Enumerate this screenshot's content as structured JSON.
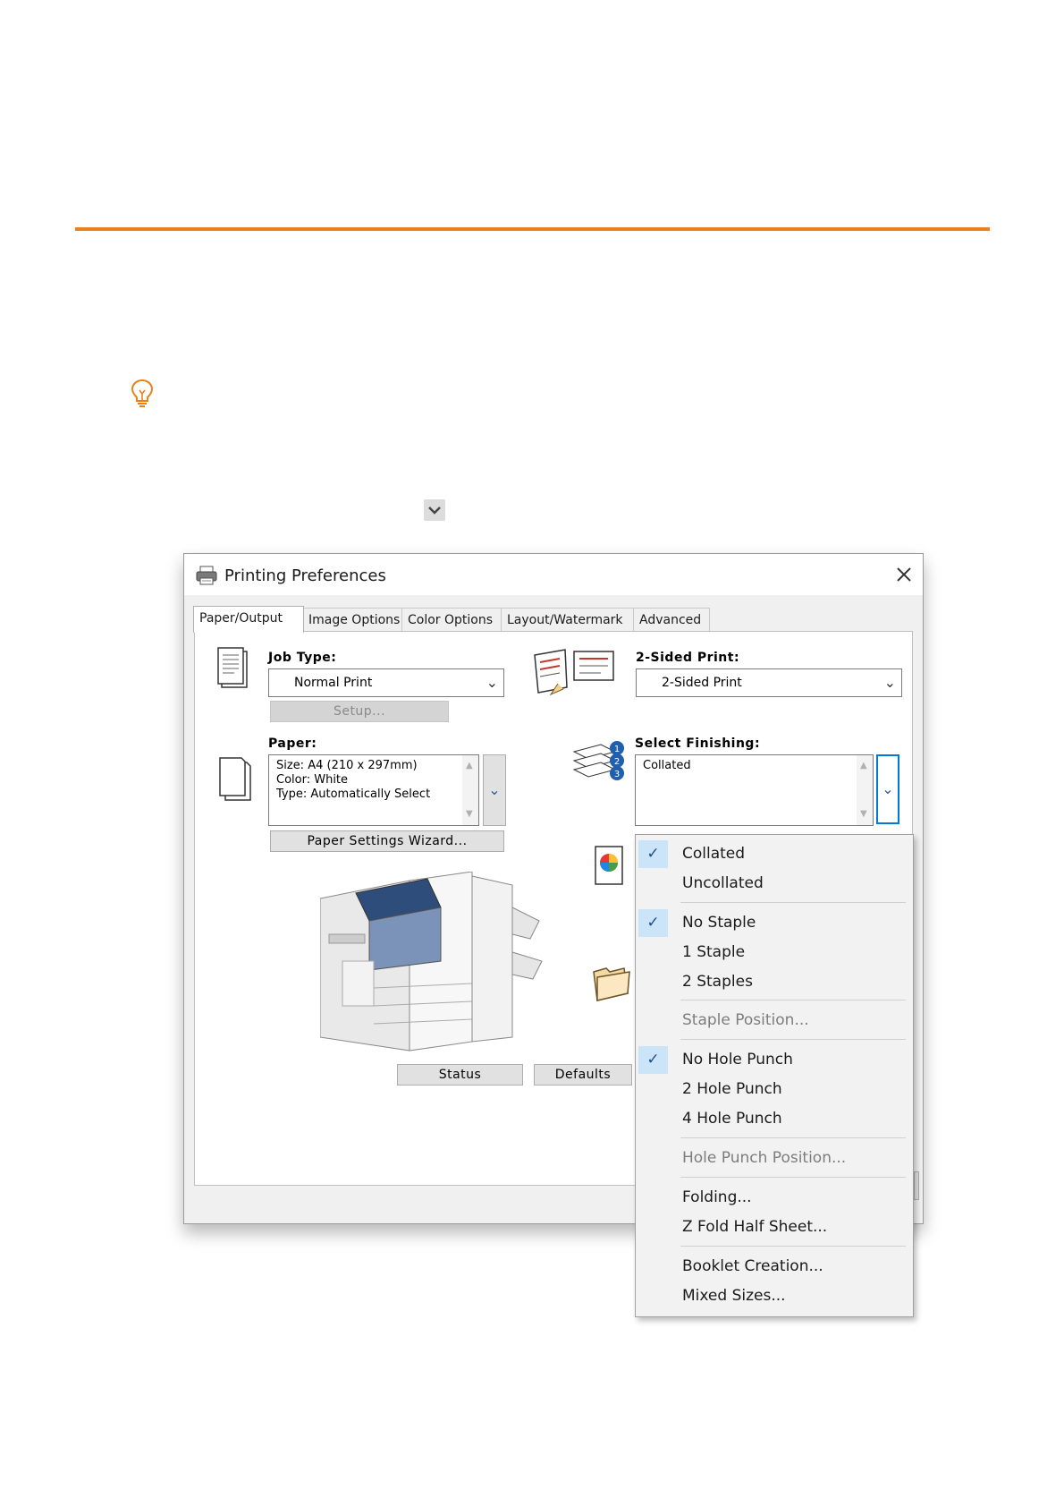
{
  "dialog": {
    "title": "Printing Preferences",
    "tabs": [
      "Paper/Output",
      "Image Options",
      "Color Options",
      "Layout/Watermark",
      "Advanced"
    ],
    "job_type": {
      "label": "Job Type:",
      "value": "Normal Print",
      "setup_label": "Setup..."
    },
    "two_sided": {
      "label": "2-Sided Print:",
      "value": "2-Sided Print"
    },
    "paper": {
      "label": "Paper:",
      "lines": [
        "Size: A4 (210 x 297mm)",
        "Color: White",
        "Type: Automatically Select"
      ],
      "wizard_label": "Paper Settings Wizard..."
    },
    "finishing": {
      "label": "Select Finishing:",
      "value": "Collated",
      "badges": [
        "1",
        "2",
        "3"
      ]
    },
    "status_label": "Status",
    "defaults_label": "Defaults"
  },
  "menu": {
    "items": [
      {
        "label": "Collated",
        "checked": true,
        "disabled": false
      },
      {
        "label": "Uncollated",
        "checked": false,
        "disabled": false
      },
      {
        "label": "No Staple",
        "checked": true,
        "disabled": false
      },
      {
        "label": "1 Staple",
        "checked": false,
        "disabled": false
      },
      {
        "label": "2 Staples",
        "checked": false,
        "disabled": false
      },
      {
        "label": "Staple Position...",
        "checked": false,
        "disabled": true
      },
      {
        "label": "No Hole Punch",
        "checked": true,
        "disabled": false
      },
      {
        "label": "2 Hole Punch",
        "checked": false,
        "disabled": false
      },
      {
        "label": "4 Hole Punch",
        "checked": false,
        "disabled": false
      },
      {
        "label": "Hole Punch Position...",
        "checked": false,
        "disabled": true
      },
      {
        "label": "Folding...",
        "checked": false,
        "disabled": false
      },
      {
        "label": "Z Fold Half Sheet...",
        "checked": false,
        "disabled": false
      },
      {
        "label": "Booklet Creation...",
        "checked": false,
        "disabled": false
      },
      {
        "label": "Mixed Sizes...",
        "checked": false,
        "disabled": false
      }
    ]
  },
  "colors": {
    "accent_rule": "#e8821e",
    "selection": "#cce4f7",
    "focus": "#0078d7"
  }
}
